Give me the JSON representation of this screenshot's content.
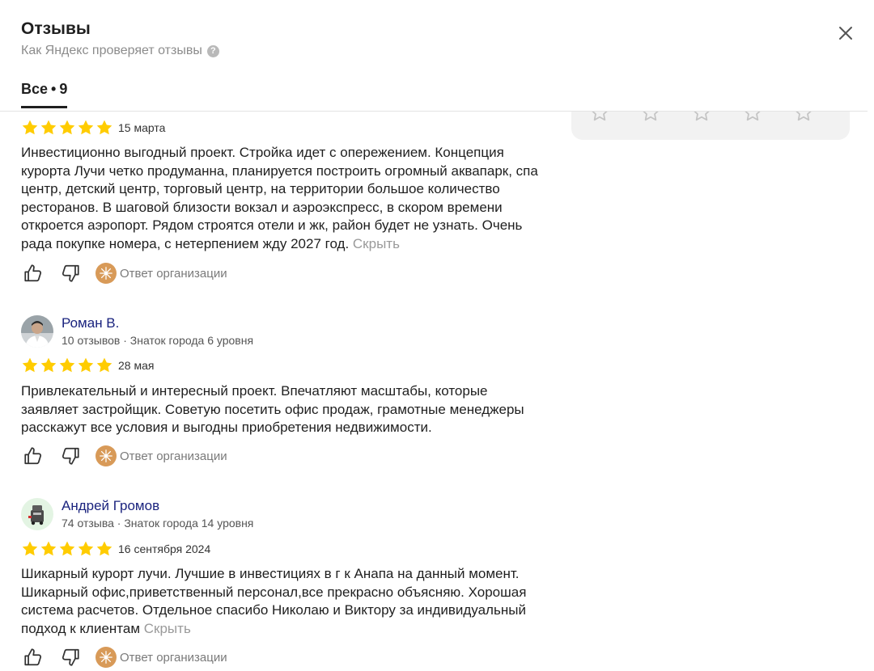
{
  "header": {
    "title": "Отзывы",
    "subtitle": "Как Яндекс проверяет отзывы",
    "help_icon": "question-circle-icon",
    "close_icon": "close-icon"
  },
  "tabs": [
    {
      "label": "Все",
      "separator": "•",
      "count": "9",
      "active": true
    }
  ],
  "colors": {
    "star": "#fc0",
    "author_link": "#1a237e",
    "muted": "#9a9a9a",
    "org_logo": "#d89a58"
  },
  "reviews": [
    {
      "rating": 5,
      "date": "15 марта",
      "text": "Инвестиционно выгодный проект. Стройка идет с опережением. Концепция курорта Лучи четко продуманна, планируется построить огромный аквапарк, спа центр, детский центр, торговый центр, на территории большое количество ресторанов. В шаговой близости вокзал и аэроэкспресс, в скором времени откроется аэропорт. Рядом строятся отели и жк, район будет не узнать. Очень рада покупке номера, с нетерпением жду 2027 год.",
      "hide_label": "Скрыть",
      "org_reply_label": "Ответ организации"
    },
    {
      "author": "Роман В.",
      "author_meta": "10 отзывов · Знаток города 6 уровня",
      "rating": 5,
      "date": "28 мая",
      "text": "Привлекательный и интересный проект. Впечатляют масштабы, которые заявляет застройщик. Советую посетить офис продаж, грамотные менеджеры расскажут все условия и выгодны приобретения недвижимости.",
      "org_reply_label": "Ответ организации"
    },
    {
      "author": "Андрей Громов",
      "author_meta": "74 отзыва · Знаток города 14 уровня",
      "rating": 5,
      "date": "16 сентября 2024",
      "text": "Шикарный курорт лучи. Лучшие в инвестициях в г к Анапа на данный момент. Шикарный офис,приветственный персонал,все прекрасно объясняю. Хорошая система расчетов. Отдельное спасибо Николаю и Виктору за индивидуальный подход к клиентам",
      "hide_label": "Скрыть",
      "org_reply_label": "Ответ организации"
    }
  ]
}
